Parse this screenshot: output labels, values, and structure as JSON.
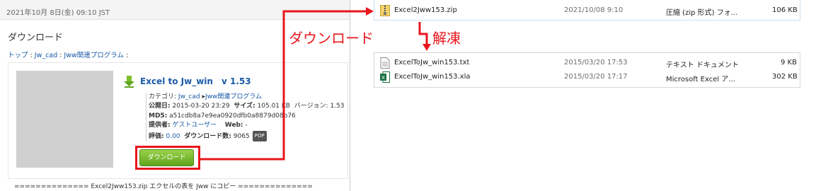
{
  "page": {
    "date": "2021年10月 8日(金) 09:10 JST",
    "title": "ダウンロード",
    "breadcrumb": [
      {
        "label": "トップ"
      },
      {
        "label": "Jw_cad"
      },
      {
        "label": "Jww関連プログラム"
      }
    ],
    "breadcrumb_sep": " : ",
    "file": {
      "name": "Excel to Jw_win",
      "version": "v 1.53",
      "category_label": "カテゴリ:",
      "category_1": "Jw_cad",
      "category_2": "Jww関連プログラム",
      "published_label": "公開日:",
      "published": "2015-03-20 23:29",
      "size_label": "サイズ:",
      "size": "105.01 KB",
      "version_label": "バージョン:",
      "version_num": "1.53",
      "md5_label": "MD5:",
      "md5": "a51cdb8a7e9ea0920dfb0a8879d08b76",
      "provider_label": "提供者:",
      "provider": "ゲストユーザー",
      "web_label": "Web:",
      "web": "-",
      "rating_label": "評価:",
      "rating": "0.00",
      "downloads_label": "ダウンロード数:",
      "downloads": "9065",
      "pop_badge": "POP"
    },
    "download_button": "ダウンロード",
    "bottom_note": "============== Excel2Jww153.zip エクセルの表を Jww にコピー =============="
  },
  "explorer_zip": {
    "name": "Excel2Jww153.zip",
    "date": "2021/10/08 9:10",
    "type": "圧縮 (zip 形式) フォ...",
    "size": "106 KB",
    "icon": "zip-folder-icon"
  },
  "explorer_extracted": [
    {
      "name": "ExcelToJw_win153.txt",
      "date": "2015/03/20 17:53",
      "type": "テキスト ドキュメント",
      "size": "9 KB",
      "icon": "text-file-icon"
    },
    {
      "name": "ExcelToJw_win153.xla",
      "date": "2015/03/20 17:17",
      "type": "Microsoft Excel ア...",
      "size": "302 KB",
      "icon": "excel-file-icon"
    }
  ],
  "annotations": {
    "download_label": "ダウンロード",
    "extract_label": "解凍",
    "color": "#e8161d"
  },
  "colors": {
    "link": "#1a5aa8",
    "button_green": "#5fa51d"
  }
}
